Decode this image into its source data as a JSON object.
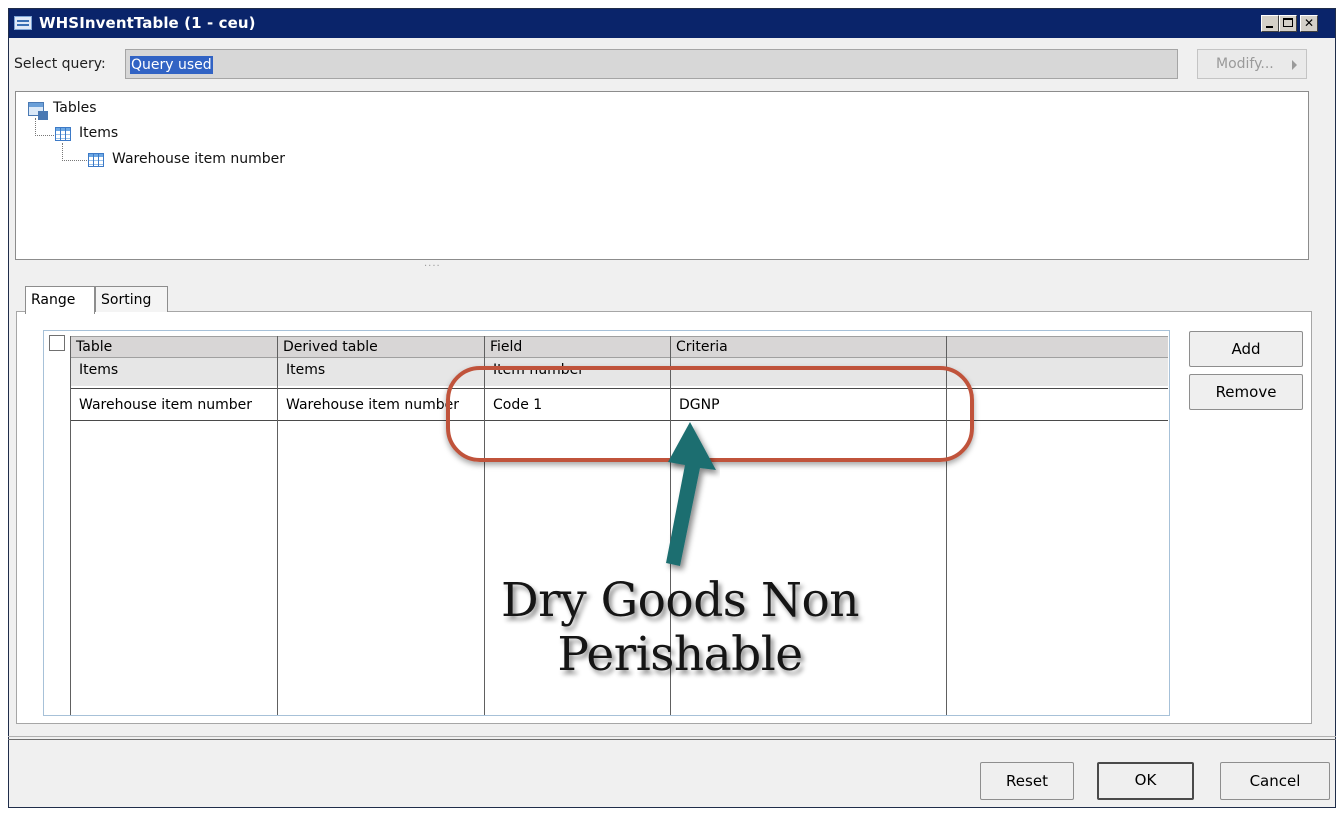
{
  "window": {
    "title": "WHSInventTable (1 - ceu)"
  },
  "select_query": {
    "label": "Select query:",
    "value": "Query used",
    "modify_label": "Modify..."
  },
  "tree": {
    "root": "Tables",
    "child": "Items",
    "grandchild": "Warehouse item number"
  },
  "tabs": [
    {
      "label": "Range"
    },
    {
      "label": "Sorting"
    }
  ],
  "grid": {
    "headers": [
      "Table",
      "Derived table",
      "Field",
      "Criteria",
      ""
    ],
    "rows": [
      {
        "table": "Items",
        "derived": "Items",
        "field": "Item number",
        "criteria": ""
      },
      {
        "table": "Warehouse item number",
        "derived": "Warehouse item number",
        "field": "Code 1",
        "criteria": "DGNP"
      }
    ]
  },
  "side_buttons": {
    "add": "Add",
    "remove": "Remove"
  },
  "footer": {
    "reset": "Reset",
    "ok": "OK",
    "cancel": "Cancel"
  },
  "annotation": {
    "line1": "Dry Goods Non",
    "line2": "Perishable",
    "oval_color": "#c0533b",
    "arrow_color": "#1f6e70"
  },
  "colors": {
    "titlebar": "#0a246a",
    "selection": "#3163c4"
  }
}
